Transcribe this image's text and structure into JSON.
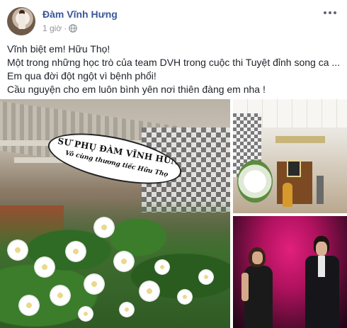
{
  "post": {
    "author": "Đàm Vĩnh Hưng",
    "timestamp": "1 giờ",
    "separator": "·",
    "privacy_icon": "globe-icon",
    "more_icon": "more-options-icon",
    "lines": [
      "Vĩnh biệt em! Hữu Thọ!",
      "Một trong những học trò của team DVH trong cuộc thi Tuyệt đỉnh song ca ...",
      "Em qua đời đột ngột vì bệnh phổi!",
      "Cầu nguyện cho em luôn bình yên nơi thiên đàng em nha !"
    ]
  },
  "photos": {
    "main_sash_line1": "SƯ PHỤ ĐÀM VĨNH HƯNG CÙNG TEAM",
    "main_sash_line2": "Vô cùng thương tiếc Hữu Thọ"
  },
  "colors": {
    "author_link": "#385898",
    "meta_text": "#90949c",
    "body_text": "#1d2129"
  }
}
